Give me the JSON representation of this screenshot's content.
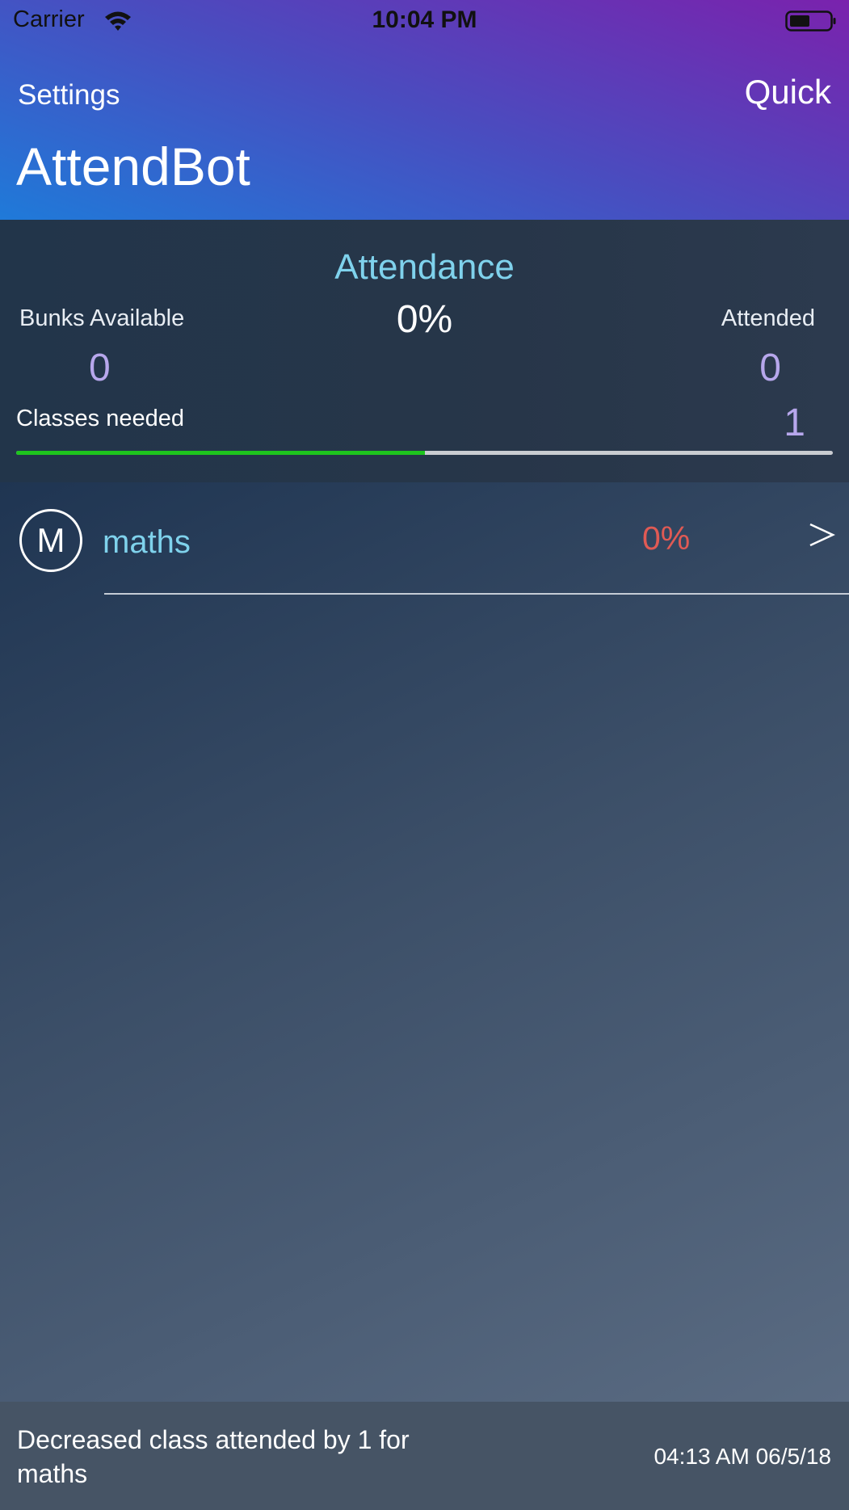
{
  "status_bar": {
    "carrier": "Carrier",
    "time": "10:04 PM",
    "wifi_icon": "wifi-icon",
    "battery_icon": "battery-icon"
  },
  "nav": {
    "left": "Settings",
    "right": "Quick",
    "title": "AttendBot"
  },
  "summary": {
    "title": "Attendance",
    "percent": "0%",
    "bunks_label": "Bunks Available",
    "bunks_value": "0",
    "attended_label": "Attended",
    "attended_value": "0",
    "needed_label": "Classes needed",
    "needed_value": "1",
    "progress_fraction": 0.5,
    "progress_color": "#1ec51e"
  },
  "subjects": [
    {
      "initial": "M",
      "name": "maths",
      "percent": "0%",
      "icon": "chevron-right-icon"
    }
  ],
  "footer": {
    "message": "Decreased class attended by 1 for maths",
    "timestamp": "04:13 AM 06/5/18"
  },
  "colors": {
    "accent_cyan": "#7fd2ec",
    "value_lavender": "#b7a7ec",
    "percent_red": "#e05a54"
  }
}
